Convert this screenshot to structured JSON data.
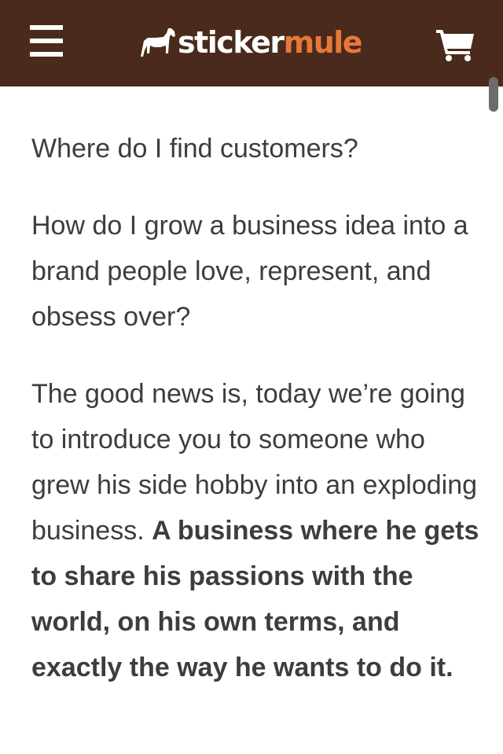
{
  "header": {
    "background_color": "#4a2a1c",
    "menu_icon": "hamburger-menu-icon",
    "logo": {
      "word1": "sticker",
      "word2": "mule",
      "word1_color": "#ffffff",
      "word2_color": "#e8773a",
      "icon": "mule-icon"
    },
    "cart_icon": "shopping-cart-icon"
  },
  "article": {
    "p1": "Where do I find customers?",
    "p2": "How do I grow a business idea into a brand people love, represent, and obsess over?",
    "p3_normal": "The good news is, today we’re going to introduce you to someone who grew his side hobby into an exploding business.",
    "p3_bold": "A business where he gets to share his passions with the world, on his own terms, and exactly the way he wants to do it."
  }
}
